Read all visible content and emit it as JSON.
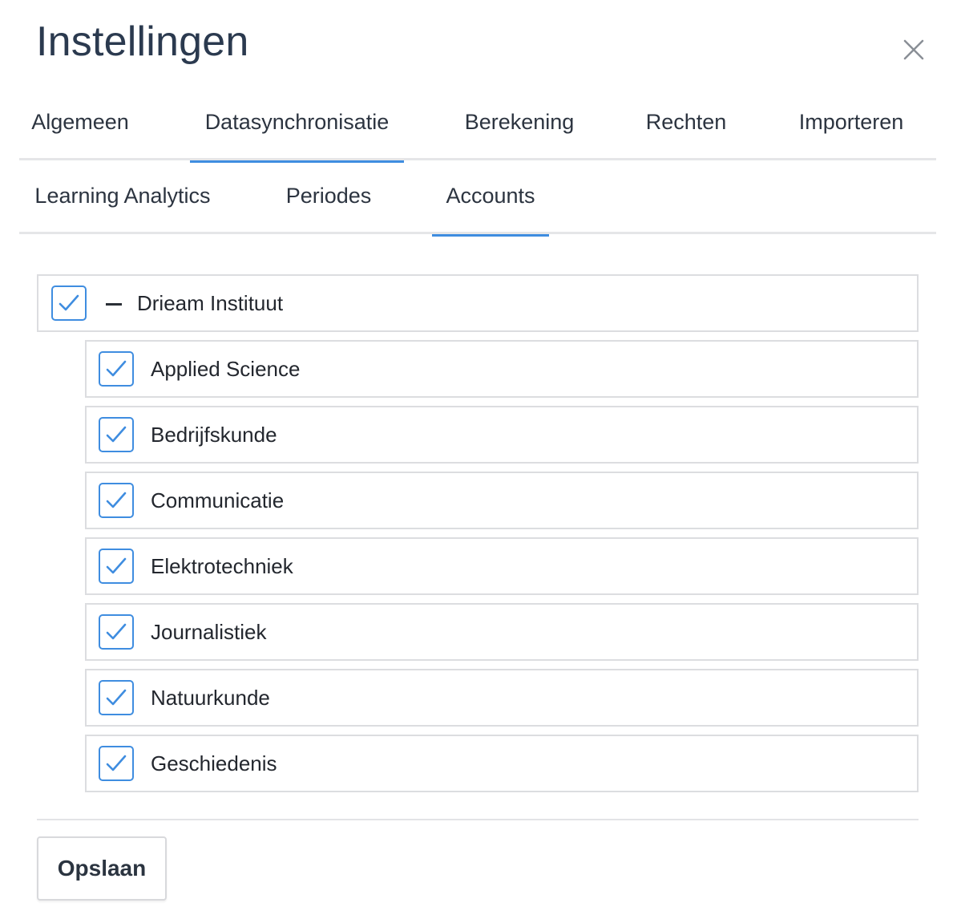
{
  "dialog": {
    "title": "Instellingen",
    "close_icon": "close-icon"
  },
  "tabs_row1": [
    {
      "label": "Algemeen",
      "active": false
    },
    {
      "label": "Datasynchronisatie",
      "active": true
    },
    {
      "label": "Berekening",
      "active": false
    },
    {
      "label": "Rechten",
      "active": false
    },
    {
      "label": "Importeren",
      "active": false
    }
  ],
  "tabs_row2": [
    {
      "label": "Learning Analytics",
      "active": false
    },
    {
      "label": "Periodes",
      "active": false
    },
    {
      "label": "Accounts",
      "active": true
    }
  ],
  "tree": {
    "root": {
      "label": "Drieam Instituut",
      "checked": true,
      "expanded": true
    },
    "children": [
      {
        "label": "Applied Science",
        "checked": true
      },
      {
        "label": "Bedrijfskunde",
        "checked": true
      },
      {
        "label": "Communicatie",
        "checked": true
      },
      {
        "label": "Elektrotechniek",
        "checked": true
      },
      {
        "label": "Journalistiek",
        "checked": true
      },
      {
        "label": "Natuurkunde",
        "checked": true
      },
      {
        "label": "Geschiedenis",
        "checked": true
      }
    ]
  },
  "footer": {
    "save_label": "Opslaan"
  },
  "colors": {
    "accent": "#3f8de0",
    "border": "#dcdde0",
    "text": "#2a2f36"
  }
}
